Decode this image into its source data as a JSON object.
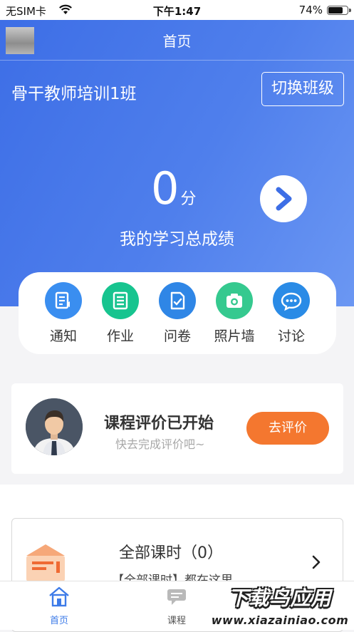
{
  "status_bar": {
    "carrier": "无SIM卡",
    "time": "下午1:47",
    "battery": "74%"
  },
  "nav": {
    "title": "首页"
  },
  "class": {
    "name": "骨干教师培训1班",
    "switch_label": "切换班级"
  },
  "score": {
    "value": "0",
    "unit": "分",
    "caption": "我的学习总成绩"
  },
  "quick_actions": [
    {
      "label": "通知",
      "icon": "notice-icon",
      "color": "#3a8ef0"
    },
    {
      "label": "作业",
      "icon": "homework-icon",
      "color": "#17c48f"
    },
    {
      "label": "问卷",
      "icon": "questionnaire-icon",
      "color": "#2f86e6"
    },
    {
      "label": "照片墙",
      "icon": "camera-icon",
      "color": "#35c98f"
    },
    {
      "label": "讨论",
      "icon": "chat-icon",
      "color": "#2a8be6"
    }
  ],
  "evaluation": {
    "title": "课程评价已开始",
    "subtitle": "快去完成评价吧~",
    "button": "去评价"
  },
  "courses": {
    "title": "全部课时（0）",
    "subtitle": "【全部课时】都在这里"
  },
  "tabs": [
    {
      "label": "首页",
      "active": true
    },
    {
      "label": "课程",
      "active": false
    }
  ],
  "watermark": {
    "title": "下载鸟应用",
    "url": "www.xiazainiao.com"
  },
  "colors": {
    "accent": "#3d6ee6",
    "orange": "#f4772f"
  }
}
